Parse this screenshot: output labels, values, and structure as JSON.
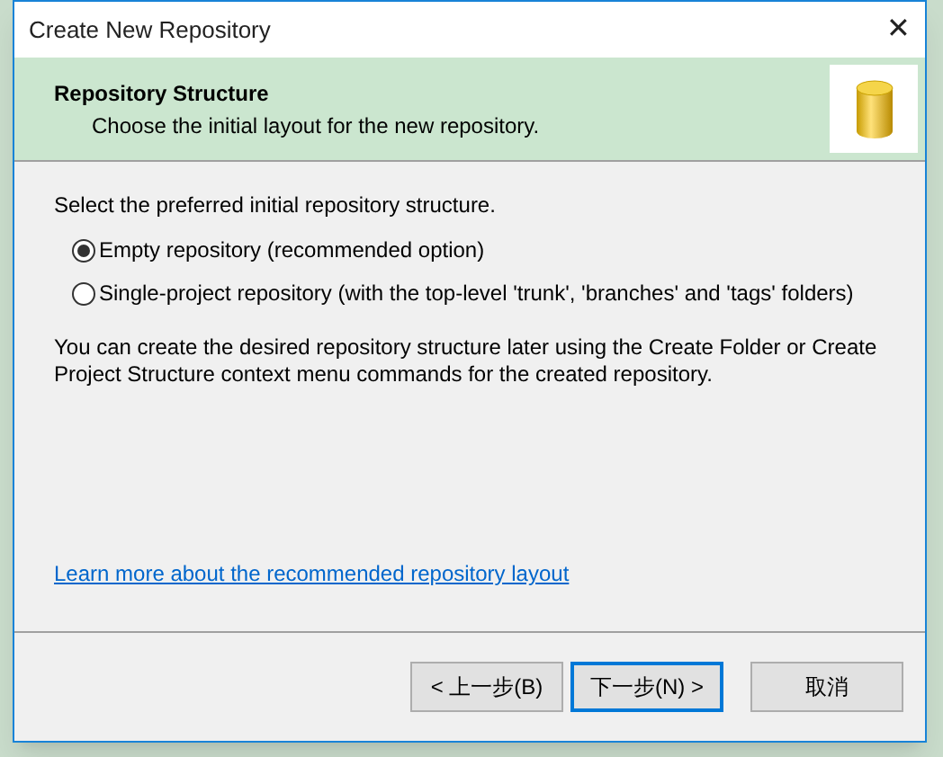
{
  "window": {
    "title": "Create New Repository",
    "close": "✕"
  },
  "header": {
    "title": "Repository Structure",
    "subtitle": "Choose the initial layout for the new repository."
  },
  "prompt": "Select the preferred initial repository structure.",
  "options": [
    {
      "label": "Empty repository (recommended option)",
      "selected": true
    },
    {
      "label": "Single-project repository (with the top-level 'trunk', 'branches' and 'tags' folders)",
      "selected": false
    }
  ],
  "note": "You can create the desired repository structure later using the Create Folder or Create Project Structure context menu commands for the created repository.",
  "link": "Learn more about the recommended repository layout",
  "buttons": [
    {
      "label": "< 上一步(B)",
      "default": false
    },
    {
      "label": "下一步(N) >",
      "default": true
    },
    {
      "label": "取消",
      "default": false
    }
  ]
}
